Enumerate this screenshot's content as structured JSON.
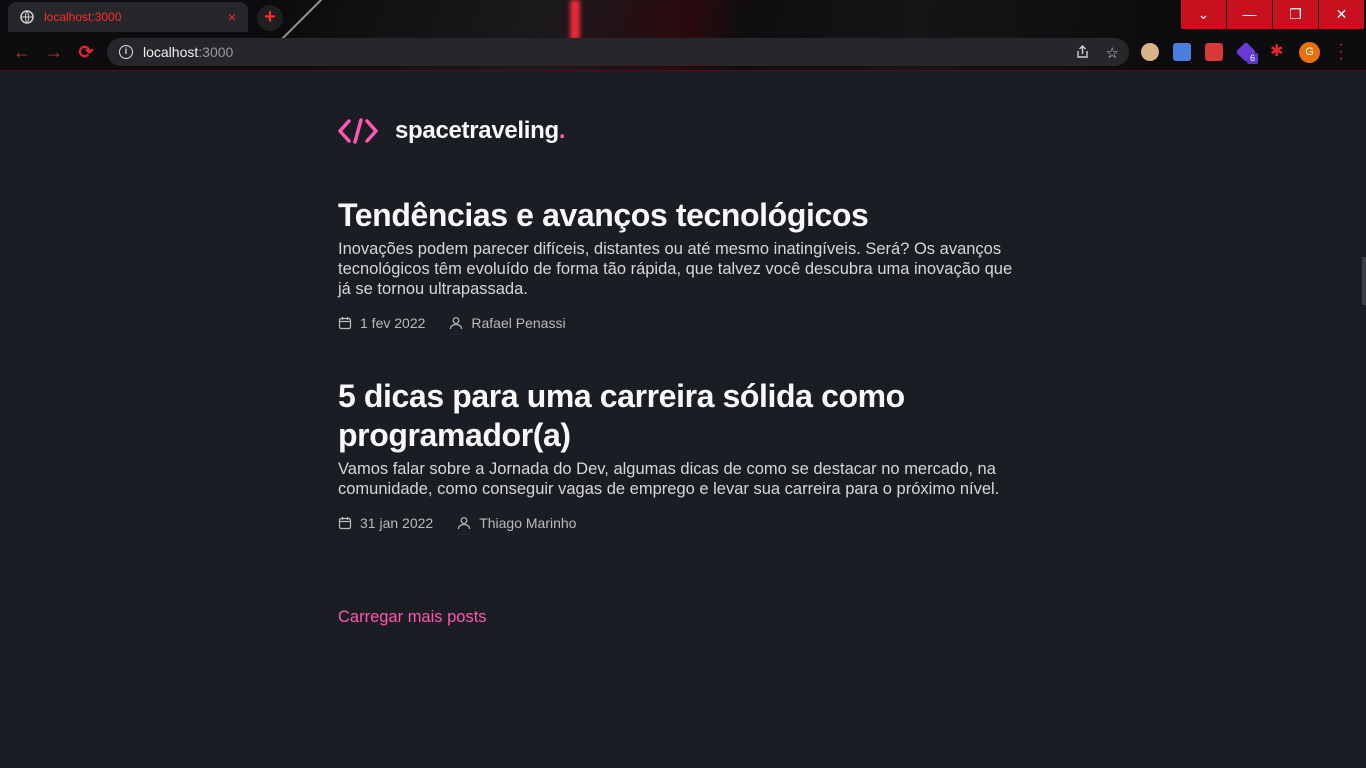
{
  "browser": {
    "tab_title": "localhost:3000",
    "tab_close_glyph": "×",
    "new_tab_glyph": "+",
    "url_host": "localhost",
    "url_port": ":3000",
    "profile_initial": "G",
    "extension_badge": "6",
    "accent": "#e8242c",
    "window_controls": [
      "⌄",
      "—",
      "❐",
      "✕"
    ]
  },
  "site": {
    "brand": "spacetraveling",
    "brand_dot": ".",
    "accent": "#ff57b2",
    "background": "#1a1d23"
  },
  "posts": [
    {
      "title": "Tendências e avanços tecnológicos",
      "subtitle": "Inovações podem parecer difíceis, distantes ou até mesmo inatingíveis. Será? Os avanços tecnológicos têm evoluído de forma tão rápida, que talvez você descubra uma inovação que já se tornou ultrapassada.",
      "date": "1 fev 2022",
      "author": "Rafael Penassi"
    },
    {
      "title": "5 dicas para uma carreira sólida como programador(a)",
      "subtitle": "Vamos falar sobre a Jornada do Dev, algumas dicas de como se destacar no mercado, na comunidade, como conseguir vagas de emprego e levar sua carreira para o próximo nível.",
      "date": "31 jan 2022",
      "author": "Thiago Marinho"
    }
  ],
  "load_more_label": "Carregar mais posts"
}
